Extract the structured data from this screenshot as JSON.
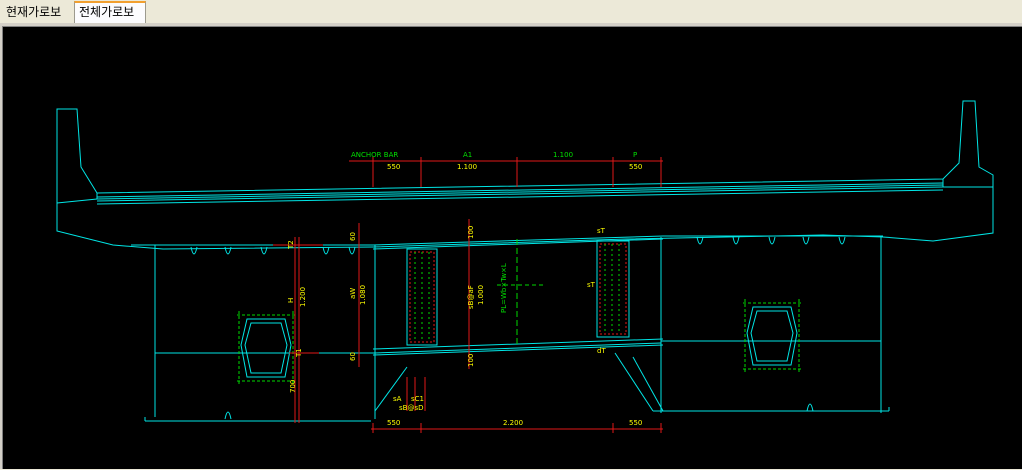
{
  "tabs": [
    {
      "label": "현재가로보",
      "active": false
    },
    {
      "label": "전체가로보",
      "active": true
    }
  ],
  "drawing": {
    "background": "#000000",
    "line_colors": {
      "outline": "#00e5e5",
      "dimension": "#e01818",
      "rebar": "#00d800",
      "text": "#ffff00"
    },
    "top_dims": {
      "labels": [
        "ANCHOR BAR",
        "A1",
        "1.100",
        "P"
      ],
      "values": [
        "550",
        "1.100",
        "550"
      ]
    },
    "left_dims": {
      "t2": "T2",
      "h": "H",
      "h_val": "1.200",
      "t1": "T1",
      "bottom": "700"
    },
    "mid_dims": {
      "top": "60",
      "w": "aW",
      "w_val": "1.080",
      "bot": "60"
    },
    "right_dims": {
      "top": "100",
      "sbf": "sB@aF",
      "val": "1.000",
      "bot": "100"
    },
    "center_label": "PL=Wb×Tw×L",
    "right_labels": {
      "st_top": "sT",
      "st_mid": "sT",
      "dt": "dT"
    },
    "bottom_labels": {
      "sa": "sA",
      "sc1": "sC1",
      "sbsd": "sB@sD"
    },
    "bottom_dims": [
      "550",
      "2.200",
      "550"
    ]
  }
}
